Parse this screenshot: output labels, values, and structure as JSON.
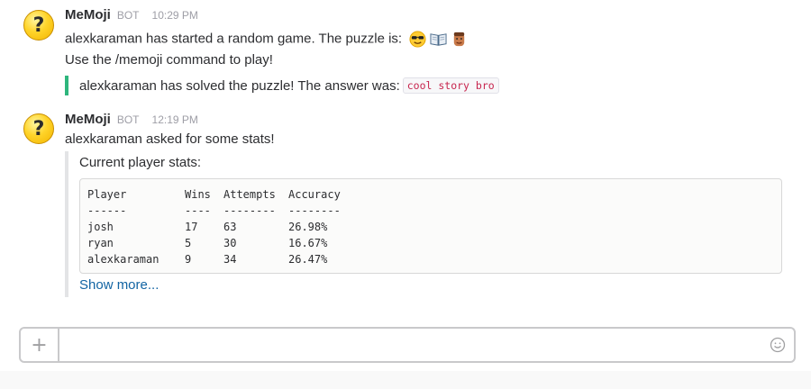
{
  "messages": [
    {
      "sender": "MeMoji",
      "badge": "BOT",
      "time": "10:29 PM",
      "lines": [
        "alexkaraman has started a random game. The puzzle is:",
        "Use the /memoji command to play!"
      ],
      "puzzle_emojis": [
        "sunglasses-emoji",
        "open-book-emoji",
        "man-face-emoji"
      ],
      "attachment": {
        "text": "alexkaraman has solved the puzzle! The answer was:",
        "answer": "cool story bro",
        "bar_color": "#2eb67d"
      }
    },
    {
      "sender": "MeMoji",
      "badge": "BOT",
      "time": "12:19 PM",
      "lines": [
        "alexkaraman asked for some stats!"
      ],
      "attachment": {
        "title": "Current player stats:",
        "table": {
          "headers": [
            "Player",
            "Wins",
            "Attempts",
            "Accuracy"
          ],
          "separators": [
            "------",
            "----",
            "--------",
            "--------"
          ],
          "rows": [
            [
              "josh",
              "17",
              "63",
              "26.98%"
            ],
            [
              "ryan",
              "5",
              "30",
              "16.67%"
            ],
            [
              "alexkaraman",
              "9",
              "34",
              "26.47%"
            ]
          ]
        },
        "show_more": "Show more...",
        "bar_color": "#e3e4e6"
      }
    }
  ],
  "composer": {
    "plus_label": "+",
    "placeholder": "",
    "value": ""
  },
  "colors": {
    "link": "#1264a3",
    "code_text": "#c7254e",
    "muted": "#9e9ea6"
  }
}
